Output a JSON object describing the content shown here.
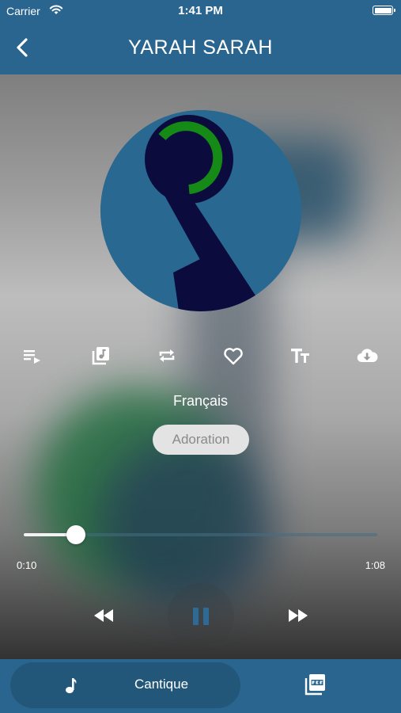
{
  "status_bar": {
    "carrier": "Carrier",
    "time": "1:41 PM"
  },
  "header": {
    "title": "YARAH SARAH",
    "back_icon": "chevron-left-icon"
  },
  "player": {
    "album_art_icon": "music-note-logo",
    "actions": [
      {
        "icon": "playlist-icon"
      },
      {
        "icon": "music-library-icon"
      },
      {
        "icon": "repeat-icon"
      },
      {
        "icon": "heart-icon"
      },
      {
        "icon": "text-size-icon"
      },
      {
        "icon": "cloud-download-icon"
      }
    ],
    "language": "Français",
    "category": "Adoration",
    "progress": {
      "fraction": 0.148,
      "current_time": "0:10",
      "total_time": "1:08"
    },
    "controls": {
      "rewind_icon": "rewind-icon",
      "pause_icon": "pause-icon",
      "forward_icon": "fast-forward-icon"
    }
  },
  "bottom_nav": {
    "tabs": [
      {
        "label": "Cantique",
        "icon": "music-note-icon",
        "active": true
      },
      {
        "label": "",
        "icon": "pdf-icon",
        "active": false
      }
    ]
  },
  "colors": {
    "primary": "#2a6590",
    "primary_dark": "#225779",
    "logo_navy": "#0b0b3d",
    "logo_green": "#168a17"
  }
}
